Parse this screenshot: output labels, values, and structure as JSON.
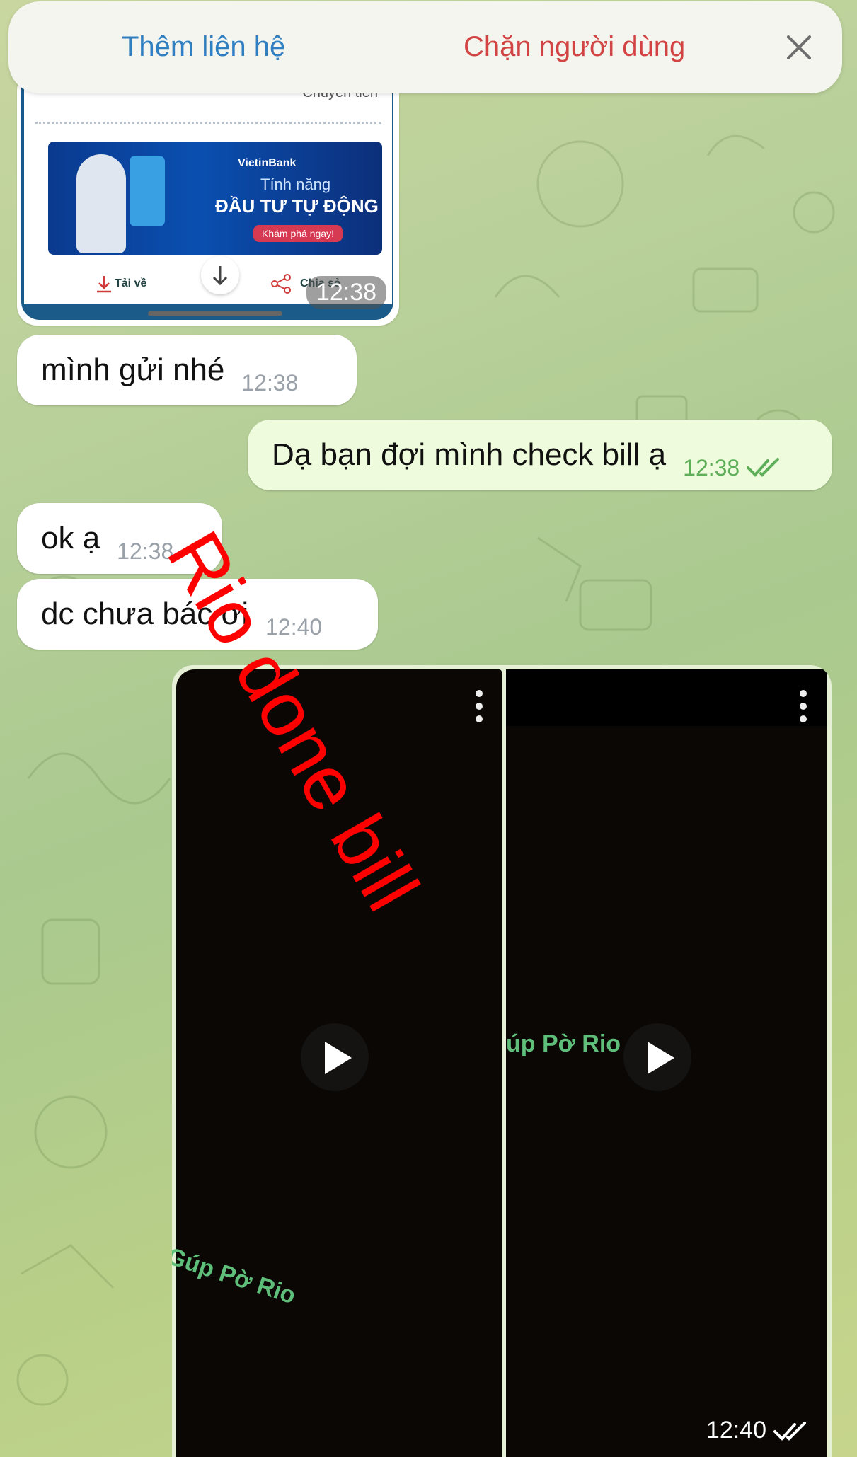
{
  "top_bar": {
    "add_contact": "Thêm liên hệ",
    "block_user": "Chặn người dùng",
    "close_icon": "close-icon"
  },
  "image_card": {
    "partial_text": "Chuyển tiền",
    "banner": {
      "brand": "VietinBank",
      "line1": "Tính năng",
      "line2": "ĐẦU TƯ TỰ ĐỘNG",
      "cta": "Khám phá ngay!"
    },
    "download_label": "Tải về",
    "share_label": "Chia sẻ",
    "time": "12:38"
  },
  "messages": [
    {
      "direction": "in",
      "text": "mình gửi nhé",
      "time": "12:38"
    },
    {
      "direction": "out",
      "text": "Dạ bạn đợi mình check bill ạ",
      "time": "12:38",
      "status": "read"
    },
    {
      "direction": "in",
      "text": "ok ạ",
      "time": "12:38"
    },
    {
      "direction": "in",
      "text": "dc chưa bác ơi",
      "time": "12:40"
    }
  ],
  "media_message": {
    "time": "12:40",
    "status": "read",
    "videos": [
      {
        "watermark": "Gúp Pờ Rio"
      },
      {
        "watermark": "úp Pờ Rio"
      }
    ]
  },
  "overlay": {
    "text": "Rio done bill",
    "color": "#ff0000"
  },
  "colors": {
    "outgoing_bubble": "#eefbdc",
    "incoming_bubble": "#ffffff",
    "accent_blue": "#2f7fc1",
    "danger_red": "#d24343",
    "read_check": "#5fae5a"
  }
}
